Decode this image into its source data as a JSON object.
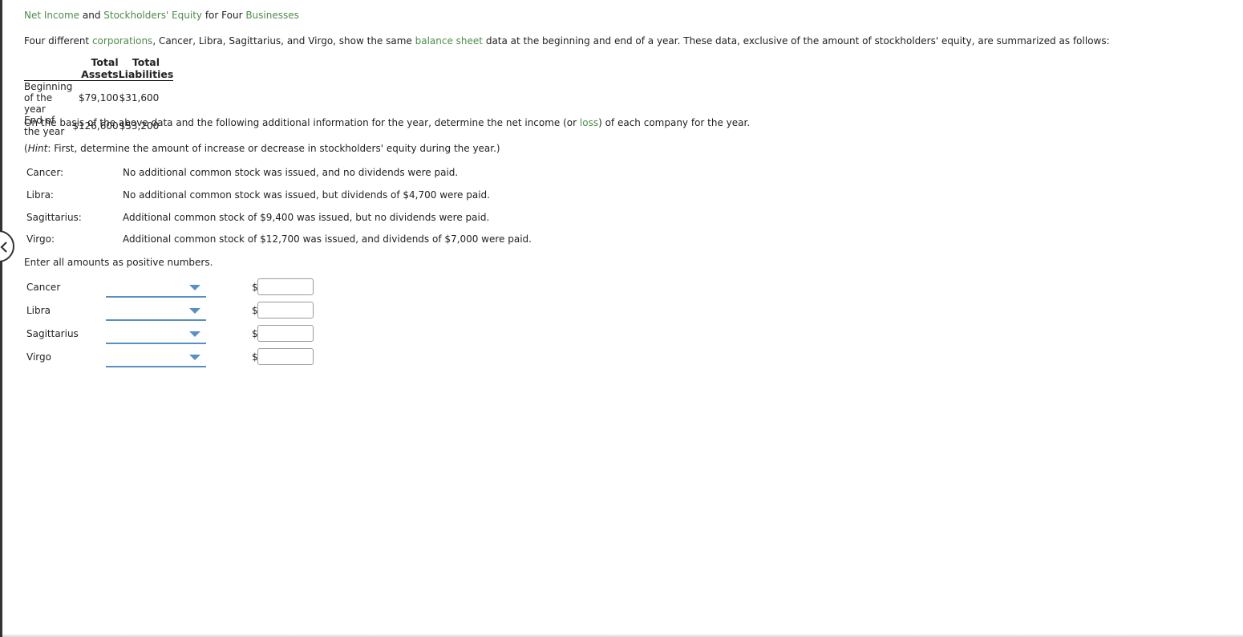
{
  "title": {
    "part1": "Net Income",
    "part2": " and ",
    "part3": "Stockholders' Equity",
    "part4": " for Four ",
    "part5": "Businesses"
  },
  "intro": {
    "part1": "Four different ",
    "part2": "corporations",
    "part3": ", Cancer, Libra, Sagittarius, and Virgo, show the same ",
    "part4": "balance sheet",
    "part5": " data at the beginning and end of a year. These data, exclusive of the amount of stockholders' equity, are summarized as follows:"
  },
  "balance_table": {
    "headers": [
      "",
      "Total Assets",
      "Total Liabilities"
    ],
    "rows": [
      {
        "label": "Beginning of the year",
        "assets": "$79,100",
        "liabilities": "$31,600"
      },
      {
        "label": "End of the year",
        "assets": "$126,600",
        "liabilities": "$53,200"
      }
    ]
  },
  "basis": {
    "part1": "On the basis of the above data and the following additional information for the year, determine the net income (or ",
    "part2": "loss",
    "part3": ") of each company for the year."
  },
  "hint": {
    "open": "(",
    "label": "Hint",
    "text": ": First, determine the amount of increase or decrease in stockholders' equity during the year.)"
  },
  "additional_info": [
    {
      "company": "Cancer:",
      "text": "No additional common stock was issued, and no dividends were paid."
    },
    {
      "company": "Libra:",
      "text": "No additional common stock was issued, but dividends of $4,700 were paid."
    },
    {
      "company": "Sagittarius:",
      "text": "Additional common stock of $9,400 was issued, but no dividends were paid."
    },
    {
      "company": "Virgo:",
      "text": "Additional common stock of $12,700 was issued, and dividends of $7,000 were paid."
    }
  ],
  "instruction": "Enter all amounts as positive numbers.",
  "answers": [
    {
      "company": "Cancer",
      "selection": "",
      "currency": "$",
      "amount": ""
    },
    {
      "company": "Libra",
      "selection": "",
      "currency": "$",
      "amount": ""
    },
    {
      "company": "Sagittarius",
      "selection": "",
      "currency": "$",
      "amount": ""
    },
    {
      "company": "Virgo",
      "selection": "",
      "currency": "$",
      "amount": ""
    }
  ],
  "colors": {
    "term_link": "#4c8c4a",
    "dropdown_accent": "#5a8fc4"
  }
}
